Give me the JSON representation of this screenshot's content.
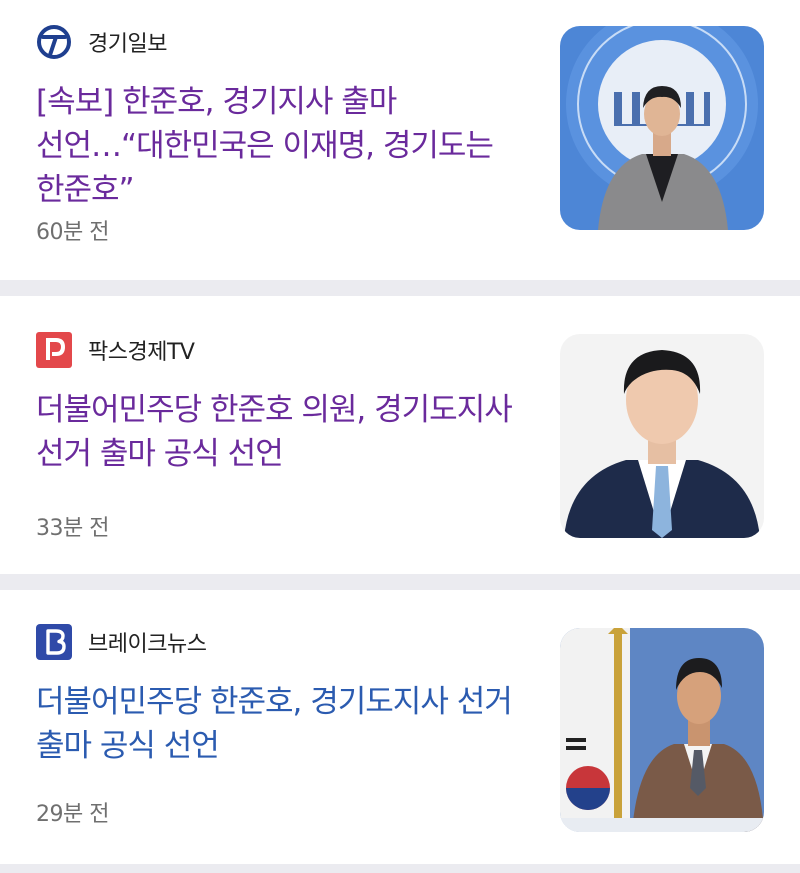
{
  "articles": [
    {
      "source": "경기일보",
      "source_icon": "gyeonggi-ilbo-logo-icon",
      "headline": "[속보] 한준호, 경기지사 출마 선언…“대한민국은 이재명, 경기도는 한준호”",
      "time": "60분 전",
      "headline_color": "#6a2a9c"
    },
    {
      "source": "팍스경제TV",
      "source_icon": "paxnet-p-logo-icon",
      "headline": "더불어민주당 한준호 의원, 경기도지사 선거 출마 공식 선언",
      "time": "33분 전",
      "headline_color": "#6a2a9c"
    },
    {
      "source": "브레이크뉴스",
      "source_icon": "breaknews-b-logo-icon",
      "headline": "더불어민주당 한준호, 경기도지사 선거 출마 공식 선언",
      "time": "29분 전",
      "headline_color": "#2b5bb0"
    }
  ]
}
